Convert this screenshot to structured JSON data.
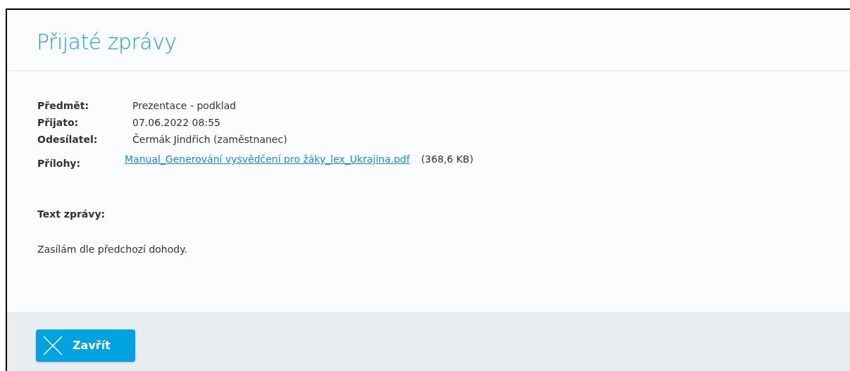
{
  "title": "Přijaté zprávy",
  "fields": [
    {
      "label": "Předmět:",
      "value": "Prezentace - podklad"
    },
    {
      "label": "Přijato:",
      "value": "07.06.2022 08:55"
    },
    {
      "label": "Odesílatel:",
      "value": "Čermák Jindřich (zaměstnanec)"
    }
  ],
  "attachments": {
    "label": "Přílohy:",
    "file": "Manual_Generování vysvědčení pro žáky_lex_Ukrajina.pdf",
    "size": "(368,6 KB)"
  },
  "message": {
    "label": "Text zprávy:",
    "body": "Zasílám dle předchozí dohody."
  },
  "buttons": [
    {
      "label": "Zavřít"
    }
  ]
}
